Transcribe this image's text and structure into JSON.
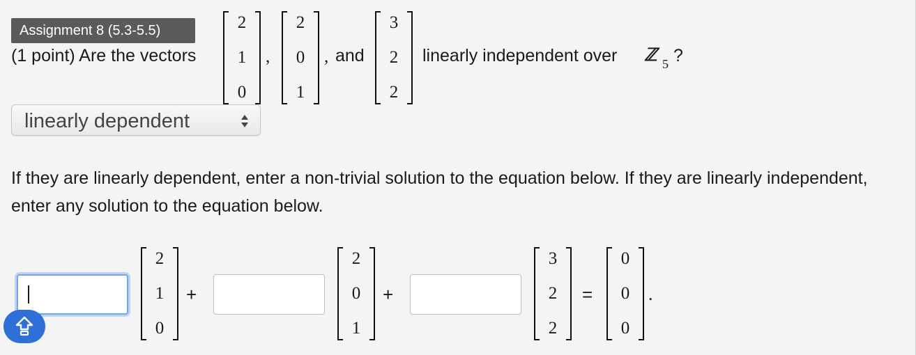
{
  "badge": {
    "label": "Assignment 8 (5.3-5.5)"
  },
  "question": {
    "prefix": "(1 point) Are the vectors",
    "comma1": ",",
    "comma2": ",",
    "and": "and",
    "suffix": "linearly independent over",
    "field_symbol": "ℤ",
    "field_subscript": "5",
    "end": "?"
  },
  "vectors": [
    {
      "entries": [
        "2",
        "1",
        "0"
      ]
    },
    {
      "entries": [
        "2",
        "0",
        "1"
      ]
    },
    {
      "entries": [
        "3",
        "2",
        "2"
      ]
    }
  ],
  "answer_select": {
    "value": "linearly dependent"
  },
  "instructions": "If they are linearly dependent, enter a non-trivial solution to the equation below. If they are linearly independent, enter any solution to the equation below.",
  "equation": {
    "plus1": "+",
    "plus2": "+",
    "equals": "=",
    "period": ".",
    "zero_vector": {
      "entries": [
        "0",
        "0",
        "0"
      ]
    },
    "coefficients": [
      {
        "value": "",
        "focused": true
      },
      {
        "value": "",
        "focused": false
      },
      {
        "value": "",
        "focused": false
      }
    ]
  },
  "icons": {
    "keyboard_toggle": "shift-arrow-icon",
    "select_arrows": "updown-arrows-icon"
  },
  "colors": {
    "focus": "#6fa8e8",
    "badge_bg": "#5a5a5a",
    "keyboard_btn": "#2f6fd8"
  }
}
